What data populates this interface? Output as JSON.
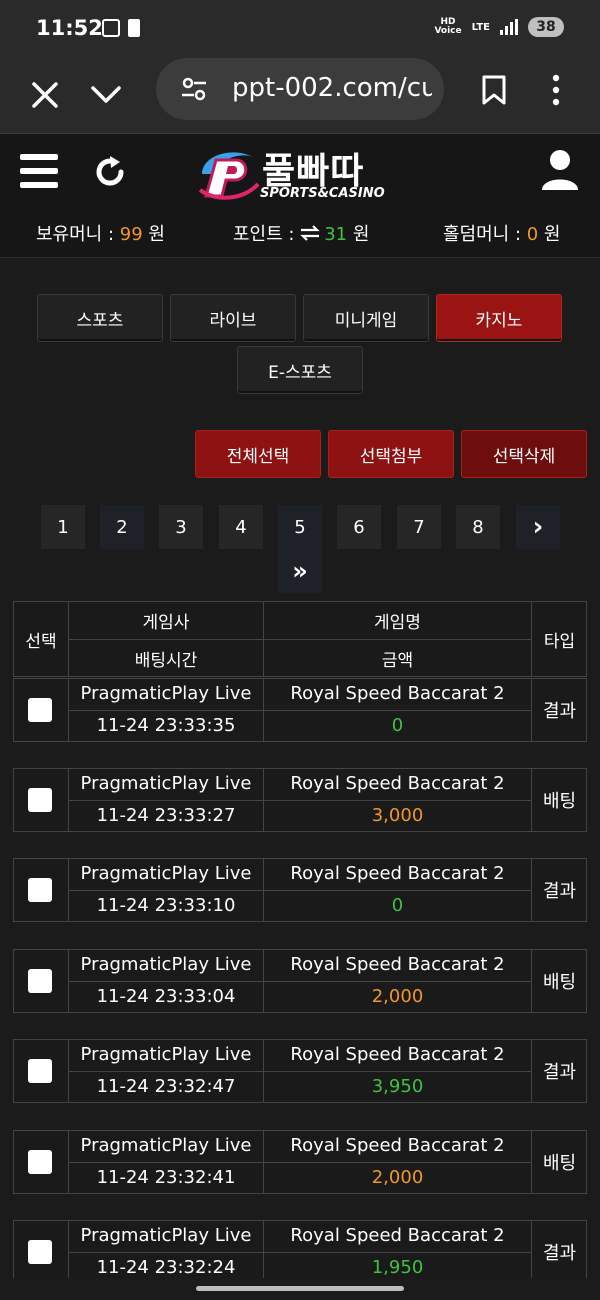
{
  "status_bar": {
    "time": "11:52",
    "hd_top": "HD",
    "hd_bottom": "Voice",
    "network": "LTE",
    "battery": "38"
  },
  "browser": {
    "url": "ppt-002.com/cu"
  },
  "header": {
    "logo_main": "풀빠따",
    "logo_sub": "SPORTS&CASINO",
    "money_label": "보유머니 : ",
    "money_value": "99",
    "money_unit": " 원",
    "point_label": "포인트 : ",
    "point_value": "31",
    "point_unit": " 원",
    "holdem_label": "홀덤머니 : ",
    "holdem_value": "0",
    "holdem_unit": " 원"
  },
  "tabs": [
    {
      "label": "스포츠"
    },
    {
      "label": "라이브"
    },
    {
      "label": "미니게임"
    },
    {
      "label": "카지노"
    },
    {
      "label": "E-스포츠"
    }
  ],
  "actions": {
    "select_all": "전체선택",
    "attach_selected": "선택첨부",
    "delete_selected": "선택삭제"
  },
  "pagination": {
    "pages": [
      "1",
      "2",
      "3",
      "4",
      "5",
      "6",
      "7",
      "8"
    ],
    "next": "›",
    "last": "»"
  },
  "table": {
    "header": {
      "select": "선택",
      "provider": "게임사",
      "game": "게임명",
      "type": "타입",
      "bet_time": "배팅시간",
      "amount": "금액"
    },
    "rows": [
      {
        "provider": "PragmaticPlay Live",
        "game": "Royal Speed Baccarat 2",
        "time": "11-24 23:33:35",
        "amount": "0",
        "type": "결과",
        "amount_color": "#3fc23f"
      },
      {
        "provider": "PragmaticPlay Live",
        "game": "Royal Speed Baccarat 2",
        "time": "11-24 23:33:27",
        "amount": "3,000",
        "type": "배팅",
        "amount_color": "#f0962a"
      },
      {
        "provider": "PragmaticPlay Live",
        "game": "Royal Speed Baccarat 2",
        "time": "11-24 23:33:10",
        "amount": "0",
        "type": "결과",
        "amount_color": "#3fc23f"
      },
      {
        "provider": "PragmaticPlay Live",
        "game": "Royal Speed Baccarat 2",
        "time": "11-24 23:33:04",
        "amount": "2,000",
        "type": "배팅",
        "amount_color": "#f0962a"
      },
      {
        "provider": "PragmaticPlay Live",
        "game": "Royal Speed Baccarat 2",
        "time": "11-24 23:32:47",
        "amount": "3,950",
        "type": "결과",
        "amount_color": "#3fc23f"
      },
      {
        "provider": "PragmaticPlay Live",
        "game": "Royal Speed Baccarat 2",
        "time": "11-24 23:32:41",
        "amount": "2,000",
        "type": "배팅",
        "amount_color": "#f0962a"
      },
      {
        "provider": "PragmaticPlay Live",
        "game": "Royal Speed Baccarat 2",
        "time": "11-24 23:32:24",
        "amount": "1,950",
        "type": "결과",
        "amount_color": "#3fc23f"
      }
    ]
  }
}
